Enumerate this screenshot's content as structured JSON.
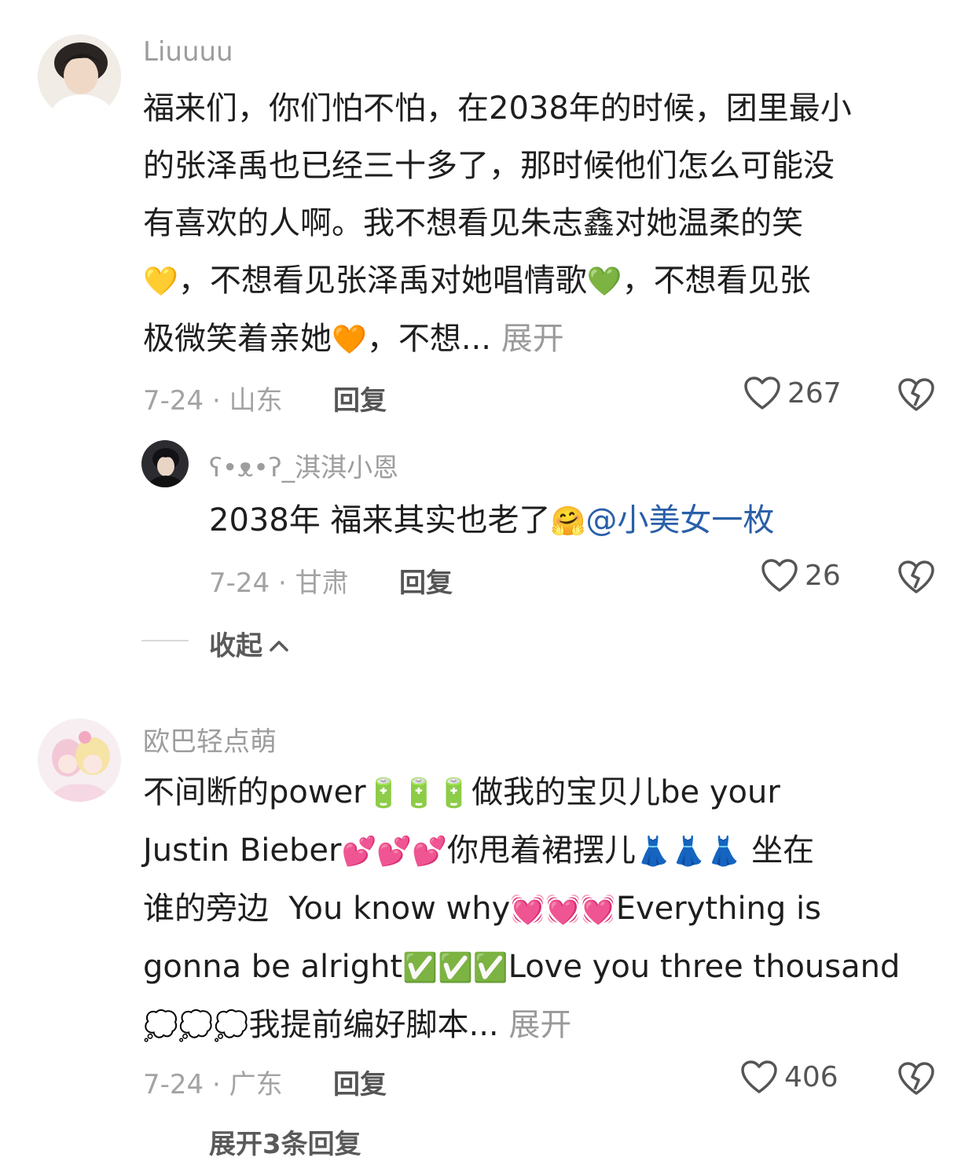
{
  "comments": [
    {
      "username": "Liuuuu",
      "text": {
        "line1": "福来们，你们怕不怕，在2038年的时候，团里最小",
        "line2": "的张泽禹也已经三十多了，那时候他们怎么可能没",
        "line3": "有喜欢的人啊。我不想看见朱志鑫对她温柔的笑",
        "line4a_emoji": "💛",
        "line4b": "，不想看见张泽禹对她唱情歌",
        "line4c_emoji": "💚",
        "line4d": "，不想看见张",
        "line5a": "极微笑着亲她",
        "line5b_emoji": "🧡",
        "line5c": "，不想...",
        "expand": "展开"
      },
      "meta": "7-24 · 山东",
      "reply_label": "回复",
      "likes": "267",
      "reply": {
        "username": "ʕ•ᴥ•ʔ_淇淇小恩",
        "text": "2038年 福来其实也老了",
        "emoji": "🤗",
        "mention": "@小美女一枚",
        "meta": "7-24 · 甘肃",
        "reply_label": "回复",
        "likes": "26"
      },
      "collapse_label": "收起"
    },
    {
      "username": "欧巴轻点萌",
      "text": {
        "line1a": "不间断的power",
        "line1b_emoji": "🔋🔋🔋",
        "line1c": "做我的宝贝儿be your",
        "line2a": "Justin Bieber",
        "line2b_emoji": "💕💕💕",
        "line2c": "你甩着裙摆儿",
        "line2d_emoji": "👗👗👗",
        "line2e": " 坐在",
        "line3a": "谁的旁边  You know why",
        "line3b_emoji": "💓💓💓",
        "line3c": "Everything is",
        "line4a": "gonna be alright",
        "line4b_emoji": "✅✅✅",
        "line4c": "Love you three thousand",
        "line5a_emoji": "💭💭💭",
        "line5b": "我提前编好脚本...",
        "expand": "展开"
      },
      "meta": "7-24 · 广东",
      "reply_label": "回复",
      "likes": "406",
      "expand_replies": "展开3条回复"
    }
  ],
  "colors": {
    "username": "#9d9d9d",
    "mention": "#2a5fa8",
    "meta": "#a3a3a3"
  },
  "icons": [
    "heart-outline-icon",
    "broken-heart-icon",
    "chevron-up-icon"
  ]
}
